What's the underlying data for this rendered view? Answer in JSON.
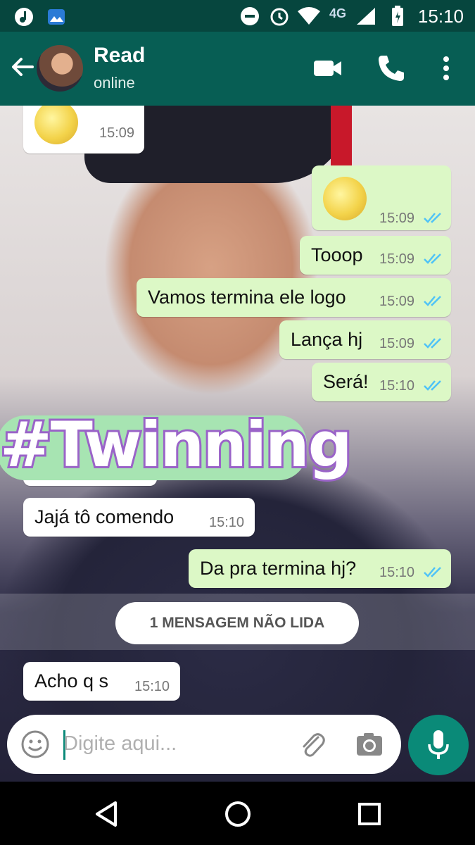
{
  "status_bar": {
    "network": "4G",
    "time": "15:10",
    "icons": [
      "music-note-icon",
      "image-icon",
      "dnd-icon",
      "alarm-icon",
      "wifi-icon",
      "signal-icon",
      "battery-icon"
    ]
  },
  "header": {
    "contact_name": "Read",
    "status": "online",
    "icons": [
      "back-arrow-icon",
      "video-call-icon",
      "phone-icon",
      "more-vert-icon"
    ],
    "color": "#075e54"
  },
  "messages": [
    {
      "dir": "in",
      "emoji": "smiling-moon-face",
      "time": "15:09"
    },
    {
      "dir": "out",
      "emoji": "smiling-moon-face",
      "time": "15:09",
      "read": true
    },
    {
      "dir": "out",
      "text": "Tooop",
      "time": "15:09",
      "read": true
    },
    {
      "dir": "out",
      "text": "Vamos termina ele logo",
      "time": "15:09",
      "read": true
    },
    {
      "dir": "out",
      "text": "Lança hj",
      "time": "15:09",
      "read": true
    },
    {
      "dir": "out",
      "text": "Será!",
      "time": "15:10",
      "read": true
    },
    {
      "dir": "in",
      "text": "Jajá tô comendo",
      "time": "15:10"
    },
    {
      "dir": "out",
      "text": "Da pra termina hj?",
      "time": "15:10",
      "read": true
    },
    {
      "dir": "in",
      "text": "Acho q s",
      "time": "15:10"
    }
  ],
  "sticker": {
    "text": "#Twinning"
  },
  "unread_banner": "1 MENSAGEM NÃO LIDA",
  "composer": {
    "placeholder": "Digite aqui...",
    "icons": [
      "emoji-icon",
      "attach-icon",
      "camera-icon",
      "mic-icon"
    ]
  },
  "colors": {
    "outgoing_bubble": "#dcf8c6",
    "incoming_bubble": "#ffffff",
    "read_ticks": "#4fc3f7",
    "mic_button": "#0a8a78"
  },
  "nav_bar": {
    "icons": [
      "nav-back-icon",
      "nav-home-icon",
      "nav-recents-icon"
    ]
  }
}
